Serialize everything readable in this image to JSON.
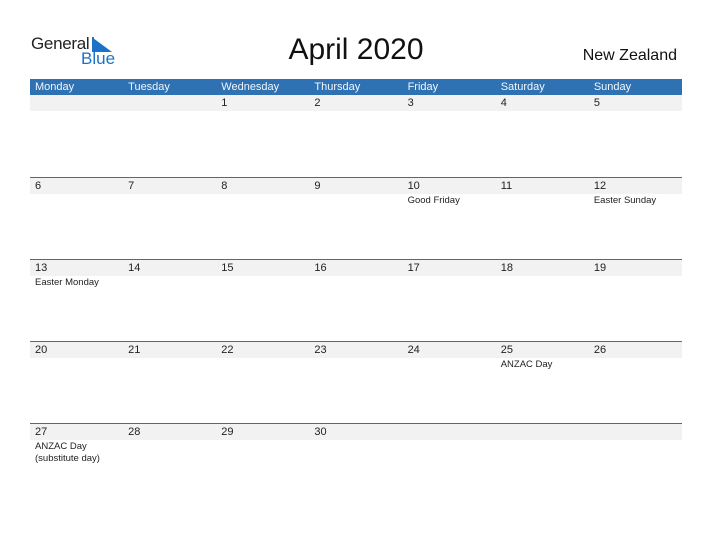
{
  "logo": {
    "general": "General",
    "blue": "Blue"
  },
  "title": "April 2020",
  "country": "New Zealand",
  "colors": {
    "header": "#2f72b3",
    "accent": "#1a73c8",
    "daybar": "#f2f2f2"
  },
  "weekdays": [
    "Monday",
    "Tuesday",
    "Wednesday",
    "Thursday",
    "Friday",
    "Saturday",
    "Sunday"
  ],
  "weeks": [
    {
      "days": [
        "",
        "",
        "1",
        "2",
        "3",
        "4",
        "5"
      ],
      "events": [
        "",
        "",
        "",
        "",
        "",
        "",
        ""
      ]
    },
    {
      "days": [
        "6",
        "7",
        "8",
        "9",
        "10",
        "11",
        "12"
      ],
      "events": [
        "",
        "",
        "",
        "",
        "Good Friday",
        "",
        "Easter Sunday"
      ]
    },
    {
      "days": [
        "13",
        "14",
        "15",
        "16",
        "17",
        "18",
        "19"
      ],
      "events": [
        "Easter Monday",
        "",
        "",
        "",
        "",
        "",
        ""
      ]
    },
    {
      "days": [
        "20",
        "21",
        "22",
        "23",
        "24",
        "25",
        "26"
      ],
      "events": [
        "",
        "",
        "",
        "",
        "",
        "ANZAC Day",
        ""
      ]
    },
    {
      "days": [
        "27",
        "28",
        "29",
        "30",
        "",
        "",
        ""
      ],
      "events": [
        "ANZAC Day\n(substitute day)",
        "",
        "",
        "",
        "",
        "",
        ""
      ]
    }
  ]
}
